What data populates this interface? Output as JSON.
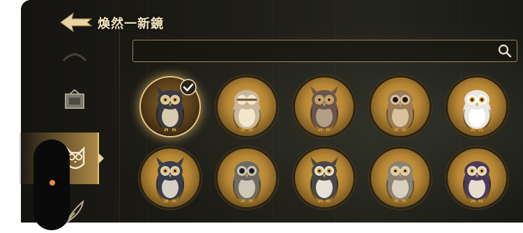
{
  "title": "煥然一新鏡",
  "search": {
    "placeholder": "",
    "value": ""
  },
  "sidebar": {
    "tabs": [
      {
        "name": "unknown-tab",
        "icon": "faded-icon"
      },
      {
        "name": "frame-tab",
        "icon": "frame-icon"
      },
      {
        "name": "owl-tab",
        "icon": "owl-icon",
        "active": true
      },
      {
        "name": "quill-tab",
        "icon": "quill-icon"
      }
    ]
  },
  "owls": [
    {
      "row": 0,
      "col": 0,
      "body": "#3a3a40",
      "chest": "#d8cbb0",
      "eyes": "#e8b33c",
      "tufts": true,
      "selected": true
    },
    {
      "row": 0,
      "col": 1,
      "body": "#c9b69a",
      "chest": "#f2e6cc",
      "eyes": "#1b1b1b",
      "tufts": false,
      "glasses": true
    },
    {
      "row": 0,
      "col": 2,
      "body": "#6b5548",
      "chest": "#b39e86",
      "eyes": "#f0a030",
      "tufts": true
    },
    {
      "row": 0,
      "col": 3,
      "body": "#9b7a56",
      "chest": "#d9c29e",
      "eyes": "#2a1f17",
      "tufts": false
    },
    {
      "row": 0,
      "col": 4,
      "body": "#e8e6e0",
      "chest": "#ffffff",
      "eyes": "#d9a128",
      "tufts": false
    },
    {
      "row": 1,
      "col": 0,
      "body": "#3b3c4a",
      "chest": "#d6d0c4",
      "eyes": "#e8b33c",
      "tufts": true
    },
    {
      "row": 1,
      "col": 1,
      "body": "#6f6a62",
      "chest": "#cfc6b6",
      "eyes": "#2a2a2a",
      "tufts": false
    },
    {
      "row": 1,
      "col": 2,
      "body": "#4a4744",
      "chest": "#e6e0d6",
      "eyes": "#e0a83a",
      "tufts": true
    },
    {
      "row": 1,
      "col": 3,
      "body": "#8d8272",
      "chest": "#d9d0bf",
      "eyes": "#e8c050",
      "tufts": false
    },
    {
      "row": 1,
      "col": 4,
      "body": "#4d3b58",
      "chest": "#e7ddd0",
      "eyes": "#e8c04a",
      "tufts": false
    }
  ],
  "colors": {
    "accent": "#e9c57c",
    "panel": "#1c1b15",
    "indicator": "#f08a35"
  }
}
